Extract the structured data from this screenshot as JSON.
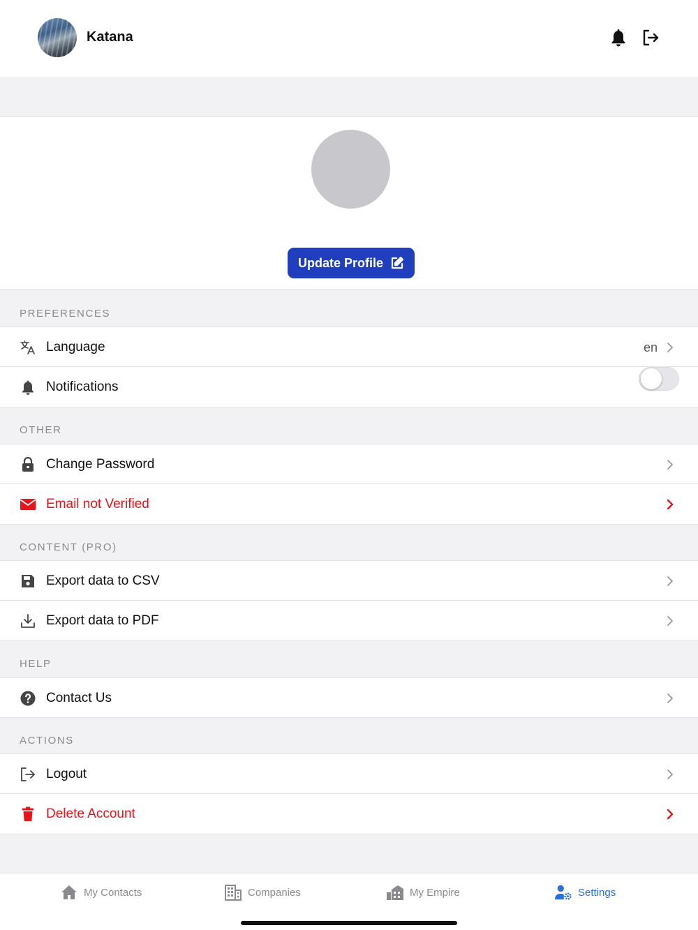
{
  "header": {
    "username": "Katana"
  },
  "profile": {
    "update_button": "Update Profile"
  },
  "sections": {
    "preferences": "PREFERENCES",
    "other": "OTHER",
    "content": "CONTENT (PRO)",
    "help": "HELP",
    "actions": "ACTIONS"
  },
  "rows": {
    "language": {
      "label": "Language",
      "value": "en"
    },
    "notifications": {
      "label": "Notifications",
      "enabled": false
    },
    "change_password": {
      "label": "Change Password"
    },
    "email_not_verified": {
      "label": "Email not Verified"
    },
    "export_csv": {
      "label": "Export data to CSV"
    },
    "export_pdf": {
      "label": "Export data to PDF"
    },
    "contact_us": {
      "label": "Contact Us"
    },
    "logout": {
      "label": "Logout"
    },
    "delete_account": {
      "label": "Delete Account"
    }
  },
  "tabs": [
    {
      "label": "My Contacts",
      "icon": "home-icon"
    },
    {
      "label": "Companies",
      "icon": "building-icon"
    },
    {
      "label": "My Empire",
      "icon": "empire-icon"
    },
    {
      "label": "Settings",
      "icon": "user-settings-icon",
      "active": true
    }
  ],
  "colors": {
    "primary": "#1f3fbf",
    "danger": "#e5151b",
    "active_tab": "#2a6fdb",
    "muted": "#8a8a8e"
  }
}
